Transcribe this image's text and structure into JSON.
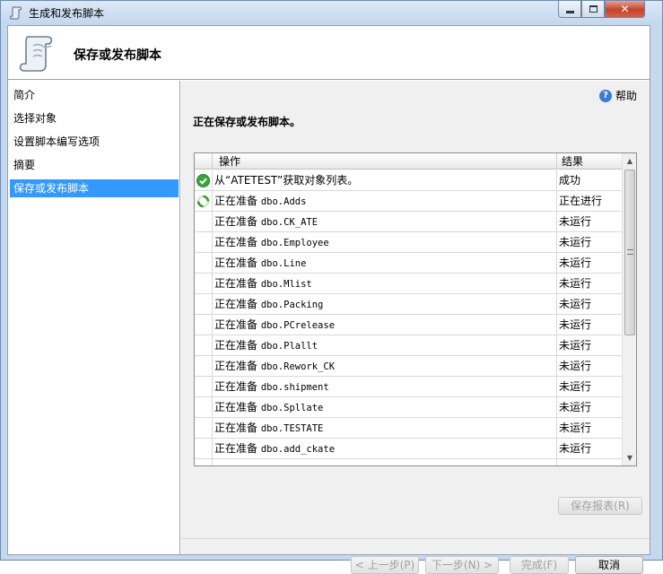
{
  "window": {
    "title": "生成和发布脚本",
    "icons": {
      "app": "script-scroll-icon",
      "minimize": "minimize-icon",
      "maximize": "maximize-icon",
      "close": "close-icon"
    }
  },
  "header": {
    "title": "保存或发布脚本",
    "icon": "script-scroll-icon"
  },
  "sidebar": {
    "items": [
      {
        "label": "简介"
      },
      {
        "label": "选择对象"
      },
      {
        "label": "设置脚本编写选项"
      },
      {
        "label": "摘要"
      },
      {
        "label": "保存或发布脚本",
        "selected": true
      }
    ]
  },
  "main": {
    "help_label": "帮助",
    "status_heading": "正在保存或发布脚本。",
    "table": {
      "columns": {
        "operation": "操作",
        "result": "结果"
      },
      "rows": [
        {
          "status_icon": "success-check-icon",
          "operation": "从“ATETEST”获取对象列表。",
          "result": "成功"
        },
        {
          "status_icon": "in-progress-spinner-icon",
          "op_prefix": "正在准备",
          "object": "dbo.Adds",
          "result": "正在进行"
        },
        {
          "op_prefix": "正在准备",
          "object": "dbo.CK_ATE",
          "result": "未运行"
        },
        {
          "op_prefix": "正在准备",
          "object": "dbo.Employee",
          "result": "未运行"
        },
        {
          "op_prefix": "正在准备",
          "object": "dbo.Line",
          "result": "未运行"
        },
        {
          "op_prefix": "正在准备",
          "object": "dbo.Mlist",
          "result": "未运行"
        },
        {
          "op_prefix": "正在准备",
          "object": "dbo.Packing",
          "result": "未运行"
        },
        {
          "op_prefix": "正在准备",
          "object": "dbo.PCrelease",
          "result": "未运行"
        },
        {
          "op_prefix": "正在准备",
          "object": "dbo.Plallt",
          "result": "未运行"
        },
        {
          "op_prefix": "正在准备",
          "object": "dbo.Rework_CK",
          "result": "未运行"
        },
        {
          "op_prefix": "正在准备",
          "object": "dbo.shipment",
          "result": "未运行"
        },
        {
          "op_prefix": "正在准备",
          "object": "dbo.Spllate",
          "result": "未运行"
        },
        {
          "op_prefix": "正在准备",
          "object": "dbo.TESTATE",
          "result": "未运行"
        },
        {
          "op_prefix": "正在准备",
          "object": "dbo.add_ckate",
          "result": "未运行"
        }
      ]
    },
    "save_report_label": "保存报表(R)"
  },
  "footer": {
    "prev_label": "< 上一步(P)",
    "next_label": "下一步(N) >",
    "finish_label": "完成(F)",
    "cancel_label": "取消"
  }
}
